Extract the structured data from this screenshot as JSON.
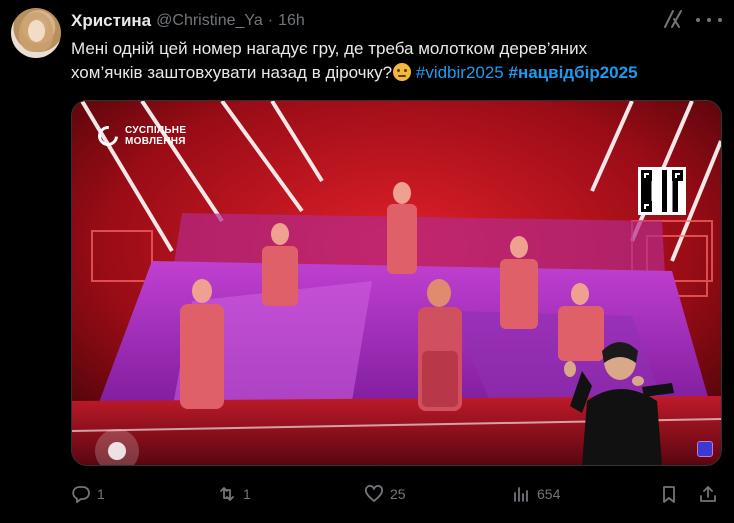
{
  "tweet": {
    "author_name": "Христина",
    "handle": "@Christine_Ya",
    "separator": "·",
    "time": "16h",
    "text_line1": "Мені одній цей номер нагадує гру, де треба молотком дерев’яних",
    "text_line2": "хом’ячків заштовхувати назад в дірочку?",
    "hashtag1": "#vidbir2025",
    "hashtag2": "#нацвідбір2025",
    "emoji": "thinking-face"
  },
  "media": {
    "logo_line1": "СУСПІЛЬНЕ",
    "logo_line2": "МОВЛЕННЯ"
  },
  "actions": {
    "replies": "1",
    "reposts": "1",
    "likes": "25",
    "views": "654"
  },
  "colors": {
    "background": "#000000",
    "text": "#e7e9ea",
    "muted": "#71767b",
    "link": "#1d9bf0"
  }
}
